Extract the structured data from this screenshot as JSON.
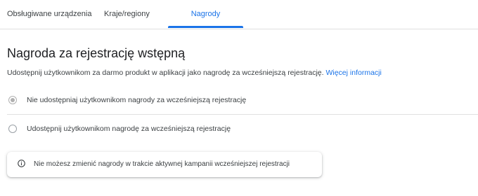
{
  "tabs": [
    {
      "label": "Obsługiwane urządzenia",
      "active": false
    },
    {
      "label": "Kraje/regiony",
      "active": false
    },
    {
      "label": "Nagrody",
      "active": true
    }
  ],
  "colors": {
    "accent": "#1a73e8",
    "text": "#3c4043",
    "divider": "#e0e0e0"
  },
  "section": {
    "title": "Nagroda za rejestrację wstępną",
    "description": "Udostępnij użytkownikom za darmo produkt w aplikacji jako nagrodę za wcześniejszą rejestrację.",
    "link": "Więcej informacji"
  },
  "options": [
    {
      "label": "Nie udostępniaj użytkownikom nagrody za wcześniejszą rejestrację",
      "checked": true
    },
    {
      "label": "Udostępnij użytkownikom nagrodę za wcześniejszą rejestrację",
      "checked": false
    }
  ],
  "info": {
    "icon": "info-icon",
    "text": "Nie możesz zmienić nagrody w trakcie aktywnej kampanii wcześniejszej rejestracji"
  }
}
